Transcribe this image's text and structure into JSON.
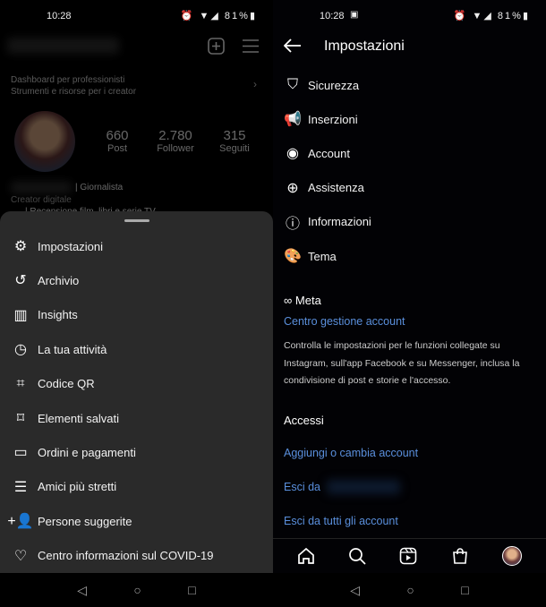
{
  "left": {
    "status": {
      "time": "10:28",
      "battery": "81%"
    },
    "profile": {
      "dashboard_title": "Dashboard per professionisti",
      "dashboard_subtitle": "Strumenti e risorse per i creator",
      "stats": [
        {
          "value": "660",
          "label": "Post"
        },
        {
          "value": "2.780",
          "label": "Follower"
        },
        {
          "value": "315",
          "label": "Seguiti"
        }
      ],
      "bio_role": "| Giornalista",
      "category": "Creator digitale",
      "bio_line": "| Recensione film, libri e serie TV"
    },
    "menu": [
      {
        "label": "Impostazioni",
        "icon": "settings-icon"
      },
      {
        "label": "Archivio",
        "icon": "archive-icon"
      },
      {
        "label": "Insights",
        "icon": "insights-icon"
      },
      {
        "label": "La tua attività",
        "icon": "activity-icon"
      },
      {
        "label": "Codice QR",
        "icon": "qr-code-icon"
      },
      {
        "label": "Elementi salvati",
        "icon": "bookmark-icon"
      },
      {
        "label": "Ordini e pagamenti",
        "icon": "card-icon"
      },
      {
        "label": "Amici più stretti",
        "icon": "close-friends-icon"
      },
      {
        "label": "Persone suggerite",
        "icon": "add-person-icon"
      },
      {
        "label": "Centro informazioni sul COVID-19",
        "icon": "covid-icon"
      }
    ]
  },
  "right": {
    "status": {
      "time": "10:28",
      "battery": "81%"
    },
    "title": "Impostazioni",
    "items": [
      {
        "label": "Sicurezza",
        "icon": "shield-icon"
      },
      {
        "label": "Inserzioni",
        "icon": "megaphone-icon"
      },
      {
        "label": "Account",
        "icon": "account-icon"
      },
      {
        "label": "Assistenza",
        "icon": "lifebuoy-icon"
      },
      {
        "label": "Informazioni",
        "icon": "info-icon"
      },
      {
        "label": "Tema",
        "icon": "palette-icon"
      }
    ],
    "meta_label": "Meta",
    "account_center": "Centro gestione account",
    "account_center_desc": "Controlla le impostazioni per le funzioni collegate su Instagram, sull'app Facebook e su Messenger, inclusa la condivisione di post e storie e l'accesso.",
    "accessi_heading": "Accessi",
    "add_account": "Aggiungi o cambia account",
    "logout": "Esci da",
    "logout_all": "Esci da tutti gli account"
  }
}
